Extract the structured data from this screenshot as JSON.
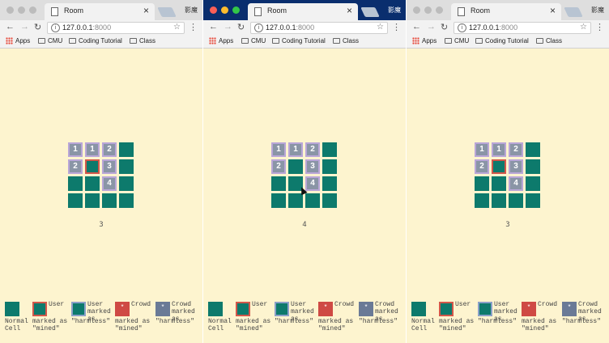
{
  "browser": {
    "tab_title": "Room",
    "tab_close": "×",
    "profile": "影魔",
    "url_host": "127.0.0.1",
    "url_port": ":8000",
    "bookmarks": [
      "Apps",
      "CMU",
      "Coding Tutorial",
      "Class"
    ]
  },
  "windows": [
    {
      "counter": "3",
      "cells": [
        {
          "type": "rev",
          "num": "1"
        },
        {
          "type": "rev",
          "num": "1"
        },
        {
          "type": "rev",
          "num": "2"
        },
        {
          "type": "hidden",
          "num": ""
        },
        {
          "type": "rev",
          "num": "2"
        },
        {
          "type": "mined",
          "num": ""
        },
        {
          "type": "rev",
          "num": "3"
        },
        {
          "type": "hidden",
          "num": ""
        },
        {
          "type": "hidden",
          "num": ""
        },
        {
          "type": "hidden",
          "num": ""
        },
        {
          "type": "rev",
          "num": "4"
        },
        {
          "type": "hidden",
          "num": ""
        },
        {
          "type": "hidden",
          "num": ""
        },
        {
          "type": "hidden",
          "num": ""
        },
        {
          "type": "hidden",
          "num": ""
        },
        {
          "type": "hidden",
          "num": ""
        }
      ]
    },
    {
      "counter": "4",
      "cells": [
        {
          "type": "rev",
          "num": "1"
        },
        {
          "type": "rev",
          "num": "1"
        },
        {
          "type": "rev",
          "num": "2"
        },
        {
          "type": "hidden",
          "num": ""
        },
        {
          "type": "rev",
          "num": "2"
        },
        {
          "type": "hidden",
          "num": ""
        },
        {
          "type": "rev",
          "num": "3"
        },
        {
          "type": "hidden",
          "num": ""
        },
        {
          "type": "hidden",
          "num": ""
        },
        {
          "type": "hidden",
          "num": ""
        },
        {
          "type": "rev",
          "num": "4"
        },
        {
          "type": "hidden",
          "num": ""
        },
        {
          "type": "hidden",
          "num": ""
        },
        {
          "type": "hidden",
          "num": ""
        },
        {
          "type": "hidden",
          "num": ""
        },
        {
          "type": "hidden",
          "num": ""
        }
      ]
    },
    {
      "counter": "3",
      "cells": [
        {
          "type": "rev",
          "num": "1"
        },
        {
          "type": "rev",
          "num": "1"
        },
        {
          "type": "rev",
          "num": "2"
        },
        {
          "type": "hidden",
          "num": ""
        },
        {
          "type": "rev",
          "num": "2"
        },
        {
          "type": "mined",
          "num": ""
        },
        {
          "type": "rev",
          "num": "3"
        },
        {
          "type": "hidden",
          "num": ""
        },
        {
          "type": "hidden",
          "num": ""
        },
        {
          "type": "hidden",
          "num": ""
        },
        {
          "type": "rev",
          "num": "4"
        },
        {
          "type": "hidden",
          "num": ""
        },
        {
          "type": "hidden",
          "num": ""
        },
        {
          "type": "hidden",
          "num": ""
        },
        {
          "type": "hidden",
          "num": ""
        },
        {
          "type": "hidden",
          "num": ""
        }
      ]
    }
  ],
  "legend": {
    "normal": {
      "below": "Normal\nCell"
    },
    "user_mined": {
      "side": "User",
      "below": "marked as\n\"mined\""
    },
    "user_harmless": {
      "side": "User\nmarked\nas",
      "below": "\"harmless\""
    },
    "crowd_mined": {
      "symbol": "*",
      "side": "Crowd",
      "below": "marked as\n\"mined\""
    },
    "crowd_harmless": {
      "symbol": "*",
      "side": "Crowd\nmarked\nas",
      "below": "\"harmless\""
    }
  },
  "colors": {
    "page_bg": "#fdf4cf",
    "cell_hidden": "#0d7a6c",
    "cell_revealed": "#8a95a6",
    "mined_border": "#d2574a",
    "crowd_mined": "#cf4a44",
    "crowd_harmless": "#6a7a96"
  }
}
